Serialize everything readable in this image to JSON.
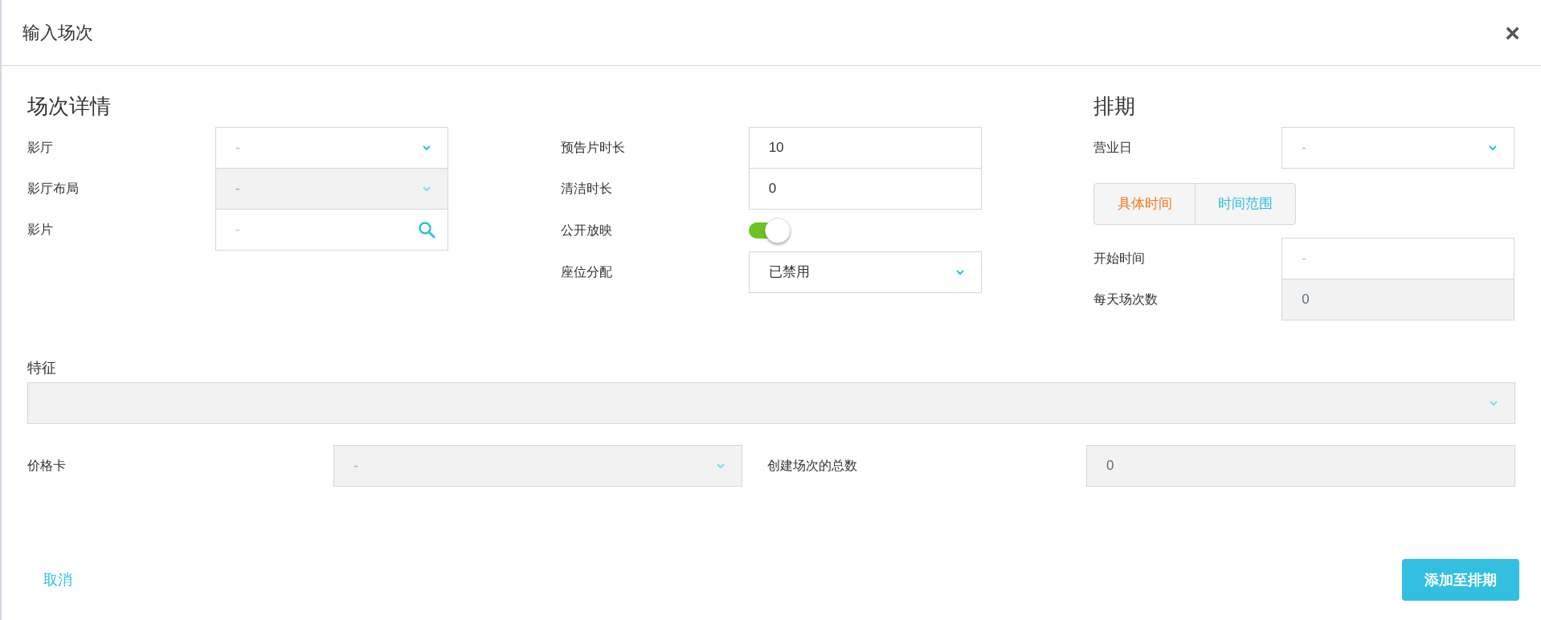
{
  "dialog": {
    "title": "输入场次",
    "close": "×"
  },
  "details": {
    "heading": "场次详情",
    "fields": [
      {
        "label": "影厅",
        "kind": "select",
        "placeholder": "-",
        "disabled": false
      },
      {
        "label": "影厅布局",
        "kind": "select",
        "placeholder": "-",
        "disabled": true
      },
      {
        "label": "影片",
        "kind": "search",
        "placeholder": "-",
        "disabled": false
      }
    ]
  },
  "timing": {
    "fields": [
      {
        "label": "预告片时长",
        "kind": "input",
        "value": "10",
        "disabled": false
      },
      {
        "label": "清洁时长",
        "kind": "input",
        "value": "0",
        "disabled": false
      },
      {
        "label": "公开放映",
        "kind": "toggle",
        "on": true
      },
      {
        "label": "座位分配",
        "kind": "select",
        "value": "已禁用",
        "disabled": false
      }
    ]
  },
  "schedule": {
    "heading": "排期",
    "business_day": {
      "label": "营业日",
      "kind": "select",
      "placeholder": "-",
      "disabled": false
    },
    "mode_buttons": [
      {
        "label": "具体时间",
        "selected": true
      },
      {
        "label": "时间范围",
        "selected": false
      }
    ],
    "fields": [
      {
        "label": "开始时间",
        "kind": "input",
        "placeholder": "-",
        "disabled": false
      },
      {
        "label": "每天场次数",
        "kind": "input",
        "value": "0",
        "disabled": true
      }
    ]
  },
  "features": {
    "label": "特征",
    "kind": "select",
    "disabled": true
  },
  "price_card": {
    "label": "价格卡",
    "kind": "select",
    "placeholder": "-",
    "disabled": true
  },
  "total": {
    "label": "创建场次的总数",
    "kind": "input",
    "value": "0",
    "disabled": true
  },
  "footer": {
    "cancel": "取消",
    "submit": "添加至排期"
  }
}
